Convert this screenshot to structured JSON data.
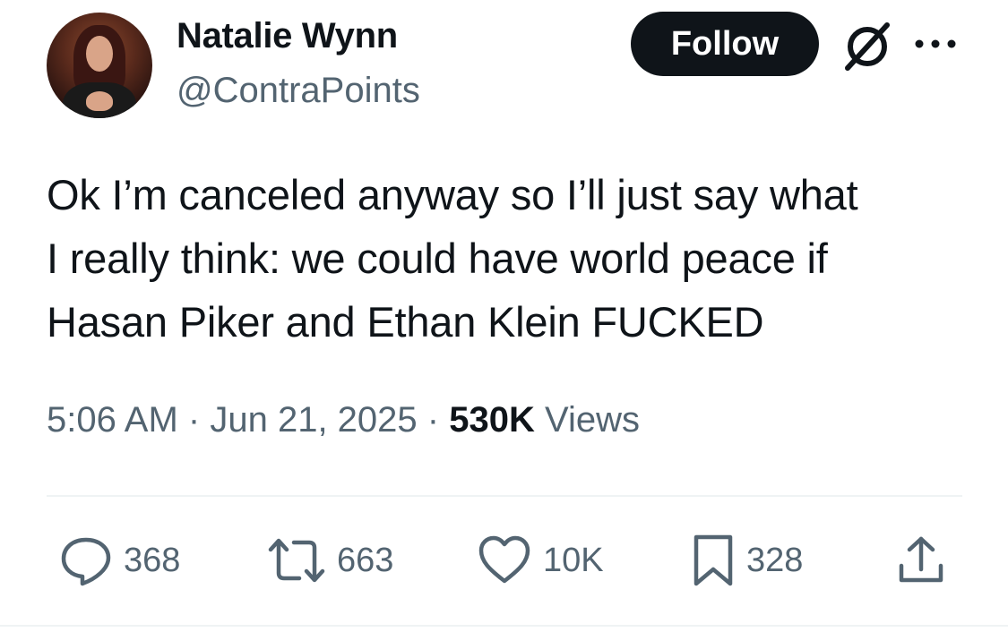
{
  "author": {
    "name": "Natalie Wynn",
    "handle": "@ContraPoints"
  },
  "header": {
    "follow_label": "Follow",
    "icons": [
      "grok-icon",
      "more-icon"
    ]
  },
  "tweet": {
    "lines": [
      "Ok I’m canceled anyway so I’ll just say what",
      "I really think: we could have world peace if",
      "Hasan Piker and Ethan Klein FUCKED"
    ],
    "time": "5:06 AM",
    "separator": "·",
    "date": "Jun 21, 2025",
    "views_count": "530K",
    "views_label": "Views"
  },
  "actions": {
    "replies": "368",
    "reposts": "663",
    "likes": "10K",
    "bookmarks": "328"
  },
  "colors": {
    "text_primary": "#0f1419",
    "text_secondary": "#536471",
    "divider": "#eff3f4",
    "button_bg": "#0f1419"
  }
}
